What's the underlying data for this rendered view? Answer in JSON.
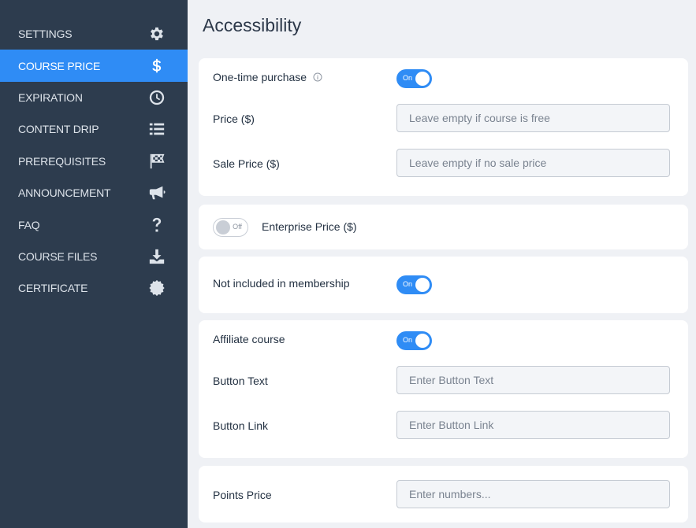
{
  "sidebar": {
    "items": [
      {
        "label": "SETTINGS",
        "icon": "gear-icon"
      },
      {
        "label": "COURSE PRICE",
        "icon": "dollar-icon",
        "active": true
      },
      {
        "label": "EXPIRATION",
        "icon": "clock-icon"
      },
      {
        "label": "CONTENT DRIP",
        "icon": "list-icon"
      },
      {
        "label": "PREREQUISITES",
        "icon": "checkered-flag-icon"
      },
      {
        "label": "ANNOUNCEMENT",
        "icon": "megaphone-icon"
      },
      {
        "label": "FAQ",
        "icon": "question-icon"
      },
      {
        "label": "COURSE FILES",
        "icon": "download-icon"
      },
      {
        "label": "CERTIFICATE",
        "icon": "certificate-icon"
      }
    ]
  },
  "main": {
    "title": "Accessibility",
    "one_time": {
      "label": "One-time purchase",
      "toggle": "On",
      "price_label": "Price ($)",
      "price_placeholder": "Leave empty if course is free",
      "sale_label": "Sale Price ($)",
      "sale_placeholder": "Leave empty if no sale price"
    },
    "enterprise": {
      "toggle": "Off",
      "label": "Enterprise Price ($)"
    },
    "membership": {
      "label": "Not included in membership",
      "toggle": "On"
    },
    "affiliate": {
      "label": "Affiliate course",
      "toggle": "On",
      "button_text_label": "Button Text",
      "button_text_placeholder": "Enter Button Text",
      "button_link_label": "Button Link",
      "button_link_placeholder": "Enter Button Link"
    },
    "points": {
      "label": "Points Price",
      "placeholder": "Enter numbers..."
    }
  },
  "colors": {
    "sidebar_bg": "#2d3c4e",
    "accent": "#2f8cf5",
    "page_bg": "#eff1f5"
  }
}
